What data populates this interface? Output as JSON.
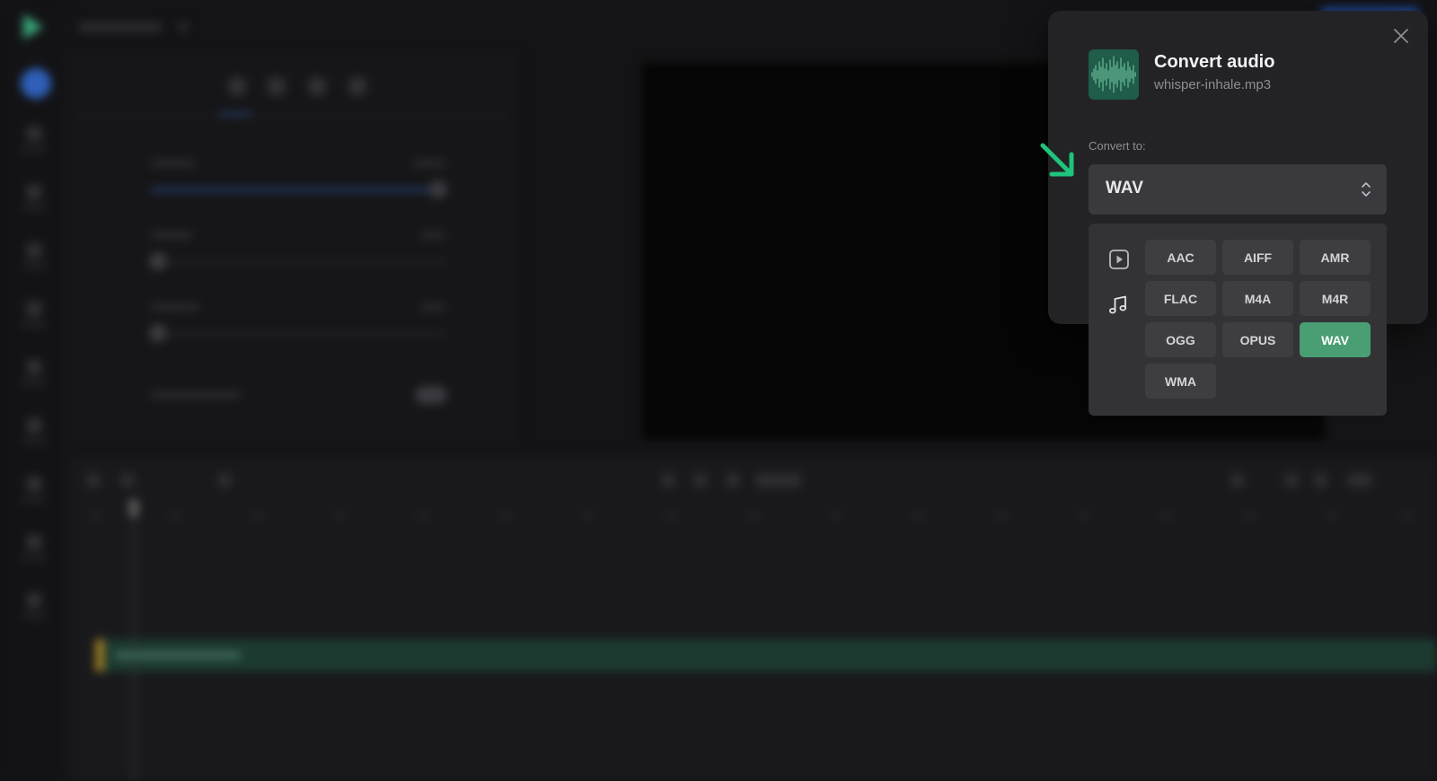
{
  "dialog": {
    "title": "Convert audio",
    "filename": "whisper-inhale.mp3",
    "convert_to_label": "Convert to:",
    "selected_format": "WAV",
    "close_icon": "close-icon",
    "categories": [
      {
        "name": "video",
        "icon": "video-play-icon"
      },
      {
        "name": "audio",
        "icon": "music-note-icon"
      }
    ],
    "formats": [
      "AAC",
      "AIFF",
      "AMR",
      "FLAC",
      "M4A",
      "M4R",
      "OGG",
      "OPUS",
      "WAV",
      "WMA"
    ],
    "colors": {
      "accent": "#4a9e73",
      "arrow": "#1fc37c",
      "dialog_bg": "#232326"
    }
  }
}
